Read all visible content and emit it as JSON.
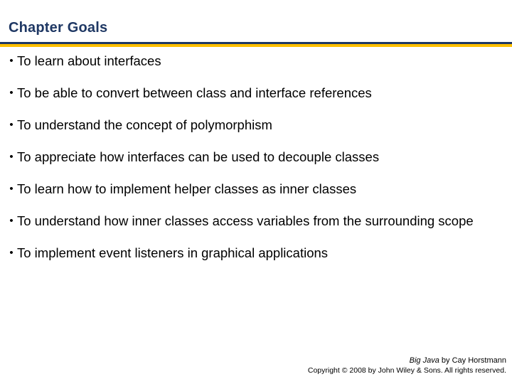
{
  "slide": {
    "title": "Chapter Goals",
    "accent_blue": "#1f3864",
    "accent_gold": "#ffc000",
    "bullet_marker": "•",
    "bullets": [
      "To learn about interfaces",
      "To be able to convert between class and interface references",
      "To understand the concept of polymorphism",
      "To appreciate how interfaces can be used to decouple classes",
      "To learn how to implement helper classes as inner classes",
      "To understand how inner classes access variables from the surrounding scope",
      "To implement event listeners in graphical applications"
    ]
  },
  "footer": {
    "book_title": "Big Java",
    "byline": " by Cay Horstmann",
    "copyright": "Copyright © 2008 by John Wiley & Sons.  All rights reserved."
  }
}
